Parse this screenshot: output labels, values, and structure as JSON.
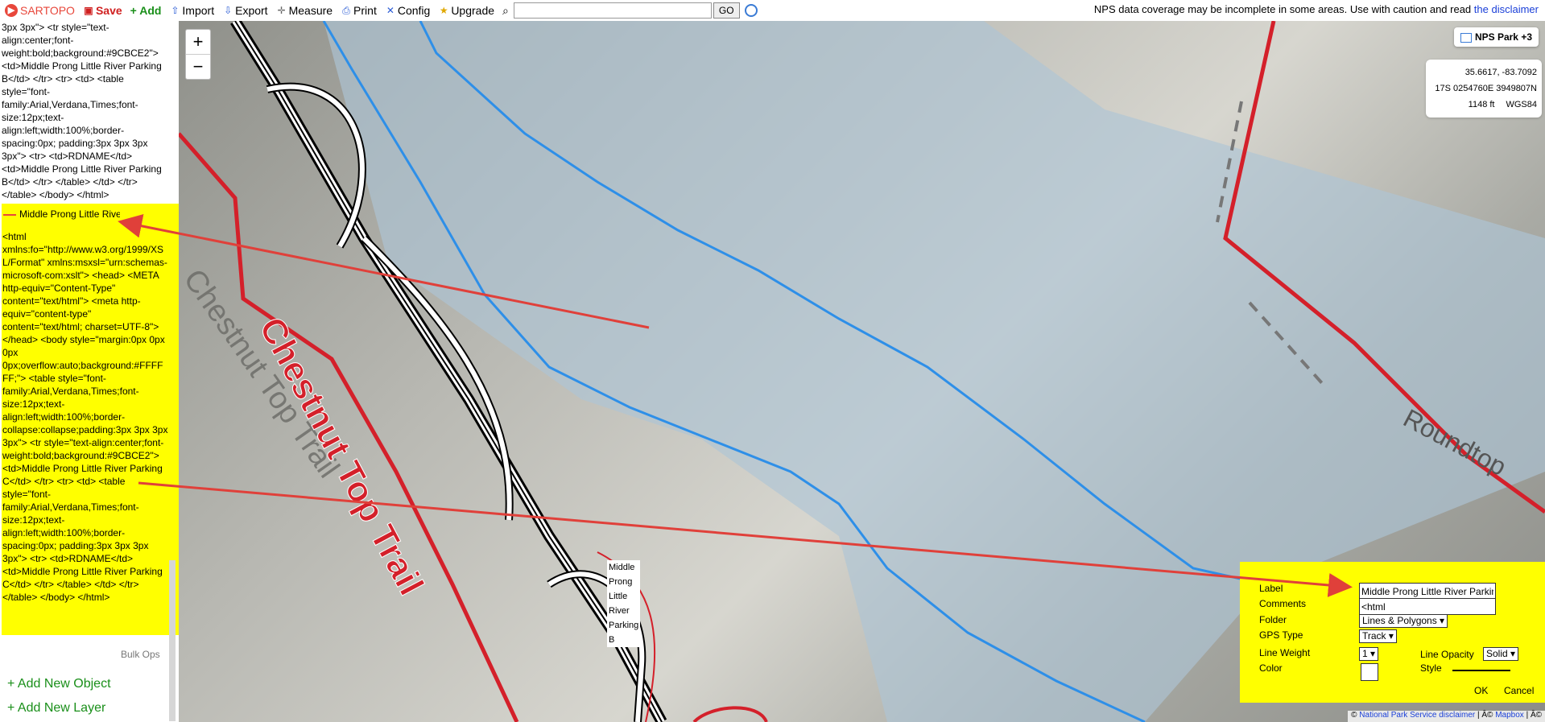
{
  "toolbar": {
    "logo_text": "SARTOPO",
    "save": "Save",
    "add": "+ Add",
    "import": "Import",
    "export": "Export",
    "measure": "Measure",
    "print": "Print",
    "config": "Config",
    "upgrade": "Upgrade",
    "search_value": "",
    "go": "GO",
    "notice": "NPS data coverage may be incomplete in some areas. Use with caution and read",
    "notice_link": "the disclaimer"
  },
  "sidebar": {
    "code_top": "3px 3px\"> <tr style=\"text-align:center;font-weight:bold;background:#9CBCE2\"> <td>Middle Prong Little River Parking B</td> </tr> <tr> <td> <table style=\"font-family:Arial,Verdana,Times;font-size:12px;text-align:left;width:100%;border-spacing:0px; padding:3px 3px 3px 3px\"> <tr> <td>RDNAME</td> <td>Middle Prong Little River Parking B</td> </tr> </table> </td> </tr> </table> </body> </html>",
    "selected_title": "Middle Prong Little River Parking C",
    "code_yellow": "<html xmlns:fo=\"http://www.w3.org/1999/XSL/Format\" xmlns:msxsl=\"urn:schemas-microsoft-com:xslt\"> <head> <META http-equiv=\"Content-Type\" content=\"text/html\"> <meta http-equiv=\"content-type\" content=\"text/html; charset=UTF-8\"> </head> <body style=\"margin:0px 0px 0px 0px;overflow:auto;background:#FFFFFF;\"> <table style=\"font-family:Arial,Verdana,Times;font-size:12px;text-align:left;width:100%;border-collapse:collapse;padding:3px 3px 3px 3px\"> <tr style=\"text-align:center;font-weight:bold;background:#9CBCE2\"> <td>Middle Prong Little River Parking C</td> </tr> <tr> <td> <table style=\"font-family:Arial,Verdana,Times;font-size:12px;text-align:left;width:100%;border-spacing:0px; padding:3px 3px 3px 3px\"> <tr> <td>RDNAME</td> <td>Middle Prong Little River Parking C</td> </tr> </table> </td> </tr> </table> </body> </html>",
    "bulk_ops": "Bulk Ops",
    "add_object": "+ Add New Object",
    "add_layer": "+ Add New Layer"
  },
  "map": {
    "zoom_in": "+",
    "zoom_out": "−",
    "layer_button": "NPS Park +3",
    "coords": {
      "latlon": "35.6617, -83.7092",
      "utm": "17S 0254760E 3949807N",
      "elevation": "1148 ft",
      "datum": "WGS84"
    },
    "trail_label_red": "Chestnut Top Trail",
    "trail_label_gray": "Chestnut Top Trail",
    "roundtop_label": "Roundtop",
    "parking_b_label": [
      "Middle",
      "Prong",
      "Little",
      "River",
      "Parking",
      "B"
    ],
    "attribution_prefix": "©",
    "attribution_nps": "National Park Service disclaimer",
    "attribution_sep": "| Â©",
    "attribution_mapbox": "Mapbox",
    "attribution_tail": "| Â©"
  },
  "editor": {
    "label_caption": "Label",
    "label_value": "Middle Prong Little River Parking C",
    "comments_caption": "Comments",
    "comments_value": "<html",
    "folder_caption": "Folder",
    "folder_value": "Lines & Polygons ▾",
    "gps_type_caption": "GPS Type",
    "gps_type_value": "Track ▾",
    "line_weight_caption": "Line Weight",
    "line_weight_value": "1 ▾",
    "line_opacity_caption": "Line Opacity",
    "line_opacity_value": "Solid ▾",
    "color_caption": "Color",
    "style_caption": "Style",
    "ok": "OK",
    "cancel": "Cancel"
  },
  "colors": {
    "boundary_red": "#d4202a",
    "water_blue": "#2e8fe8",
    "highlight_yellow": "#ffff00",
    "arrow_red": "#e0403a",
    "add_green": "#1a8f1a"
  }
}
